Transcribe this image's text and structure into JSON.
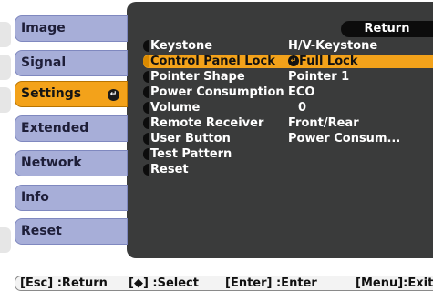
{
  "menu": {
    "items": [
      {
        "label": "Image"
      },
      {
        "label": "Signal"
      },
      {
        "label": "Settings",
        "enter_glyph": "↵"
      },
      {
        "label": "Extended"
      },
      {
        "label": "Network"
      },
      {
        "label": "Info"
      },
      {
        "label": "Reset"
      }
    ],
    "selected_index": 2
  },
  "panel": {
    "return_label": "Return",
    "rows": [
      {
        "label": "Keystone",
        "value": "H/V-Keystone"
      },
      {
        "label": "Control Panel Lock",
        "value": "Full Lock",
        "selected": true
      },
      {
        "label": "Pointer Shape",
        "value": "Pointer 1"
      },
      {
        "label": "Power Consumption",
        "value": "ECO"
      },
      {
        "label": "Volume",
        "value": "0"
      },
      {
        "label": "Remote Receiver",
        "value": "Front/Rear"
      },
      {
        "label": "User Button",
        "value": "Power Consum..."
      },
      {
        "label": "Test Pattern",
        "value": ""
      },
      {
        "label": "Reset",
        "value": ""
      }
    ]
  },
  "help": {
    "esc": "[Esc] :Return",
    "select": "[◆] :Select",
    "enter": "[Enter] :Enter",
    "menu": "[Menu]:Exit"
  },
  "colors": {
    "tab": "#a7aed8",
    "selected": "#f3a21a",
    "panel": "#3a3b3b"
  },
  "icons": {
    "enter": "enter-icon",
    "updown": "updown-arrow-icon"
  }
}
